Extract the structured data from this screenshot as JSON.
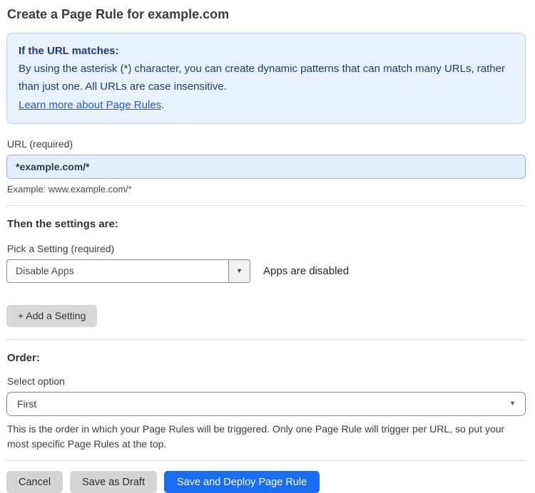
{
  "page": {
    "title": "Create a Page Rule for example.com"
  },
  "info_box": {
    "heading": "If the URL matches:",
    "body": "By using the asterisk (*) character, you can create dynamic patterns that can match many URLs, rather than just one. All URLs are case insensitive.",
    "link_label": "Learn more about Page Rules",
    "link_suffix": "."
  },
  "url_field": {
    "label": "URL (required)",
    "value": "*example.com/*",
    "helper": "Example: www.example.com/*"
  },
  "settings_section": {
    "heading": "Then the settings are:",
    "setting_label": "Pick a Setting (required)",
    "setting_value": "Disable Apps",
    "setting_status": "Apps are disabled",
    "add_setting_label": "+ Add a Setting"
  },
  "order_section": {
    "heading": "Order:",
    "select_label": "Select option",
    "select_value": "First",
    "helper": "This is the order in which your Page Rules will be triggered. Only one Page Rule will trigger per URL, so put your most specific Page Rules at the top."
  },
  "footer": {
    "cancel_label": "Cancel",
    "save_draft_label": "Save as Draft",
    "save_deploy_label": "Save and Deploy Page Rule"
  },
  "icons": {
    "caret_down": "▼"
  },
  "colors": {
    "info_bg": "#e8f1fc",
    "info_border": "#bad3f0",
    "info_text": "#1d3d7a",
    "link_blue": "#2a5cd8",
    "input_bg": "#e3eefb",
    "primary_blue": "#1a6ef5",
    "button_gray": "#d5d5d5"
  }
}
